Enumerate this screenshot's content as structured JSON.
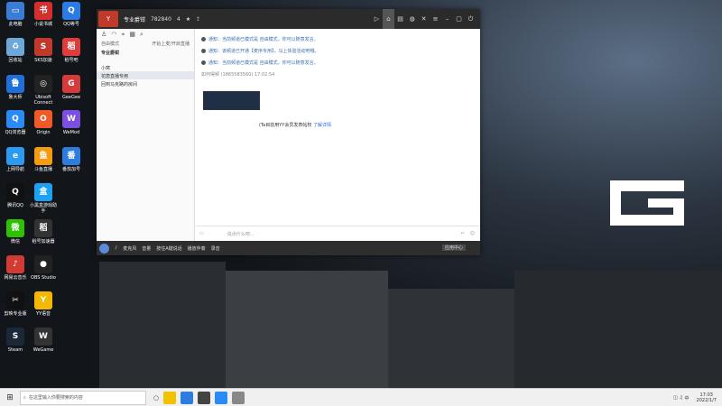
{
  "desktop_icons": [
    {
      "label": "此电脑",
      "color": "#3a7bd5",
      "glyph": "▭"
    },
    {
      "label": "小说书城",
      "color": "#d42f2f",
      "glyph": "书"
    },
    {
      "label": "QQ等号",
      "color": "#2c7be5",
      "glyph": "Q"
    },
    {
      "label": "回收站",
      "color": "#6ea8d8",
      "glyph": "♻"
    },
    {
      "label": "SKS加速",
      "color": "#c0392b",
      "glyph": "S"
    },
    {
      "label": "稻号吧",
      "color": "#e03c3c",
      "glyph": "稻"
    },
    {
      "label": "鲁大师",
      "color": "#1e6fd9",
      "glyph": "鲁"
    },
    {
      "label": "Ubisoft Connect",
      "color": "#222",
      "glyph": "◎"
    },
    {
      "label": "GeeGee",
      "color": "#d63b3b",
      "glyph": "G"
    },
    {
      "label": "QQ浏览器",
      "color": "#2a8af6",
      "glyph": "Q"
    },
    {
      "label": "Origin",
      "color": "#f05a28",
      "glyph": "O"
    },
    {
      "label": "WeMod",
      "color": "#7b4fe0",
      "glyph": "W"
    },
    {
      "label": "上网导航",
      "color": "#2b9af3",
      "glyph": "e"
    },
    {
      "label": "斗鱼直播",
      "color": "#f39c12",
      "glyph": "鱼"
    },
    {
      "label": "番茄加号",
      "color": "#2d7de0",
      "glyph": "番"
    },
    {
      "label": "腾讯QQ",
      "color": "#111",
      "glyph": "Q"
    },
    {
      "label": "小黑盒游戏助手",
      "color": "#1da1f2",
      "glyph": "盒"
    },
    {
      "label": "微信",
      "color": "#2dc100",
      "glyph": "微"
    },
    {
      "label": "稻号加速器",
      "color": "#333",
      "glyph": "稻"
    },
    {
      "label": "网易云音乐",
      "color": "#d33a31",
      "glyph": "♪"
    },
    {
      "label": "OBS Studio",
      "color": "#222",
      "glyph": "●"
    },
    {
      "label": "剪映专业版",
      "color": "#111",
      "glyph": "✂"
    },
    {
      "label": "YY语音",
      "color": "#f5b800",
      "glyph": "Y"
    },
    {
      "label": "Steam",
      "color": "#1b2838",
      "glyph": "S"
    },
    {
      "label": "WeGame",
      "color": "#333",
      "glyph": "W"
    }
  ],
  "window": {
    "title": "专业爵钳",
    "id": "782840",
    "members": "4",
    "left_header_label": "自由模式",
    "left_header_right": "开始上麦/开启直播",
    "tree": [
      {
        "label": "专业爵钳",
        "bold": true
      },
      {
        "label": "小窝",
        "bold": false
      },
      {
        "label": "花唐直播专用",
        "bold": false
      },
      {
        "label": "回到马克路的房间",
        "bold": false
      }
    ],
    "messages": [
      "通知：当前频道已模式是 自由模式，你可以随意发言。",
      "通知：该频道已开通【麦序专用】，马上体验活动吧哦。",
      "通知：当前频道已模式是 自由模式，你可以随意发言。"
    ],
    "me_line": "如何得频 (1865583560) 17:02:54",
    "fans_text": "(Ta目前用YY会员发表帖权",
    "fans_link": "了解详情",
    "input_placeholder": "说点什么吧...",
    "bottom_items": [
      "麦克风",
      "音量",
      "按住A键说话",
      "播放伴奏",
      "录音"
    ],
    "bottom_right": "应用中心"
  },
  "taskbar": {
    "search_placeholder": "在这里输入你要搜索的内容",
    "time": "17:03",
    "date": "2022/1/7",
    "lang": "中"
  }
}
